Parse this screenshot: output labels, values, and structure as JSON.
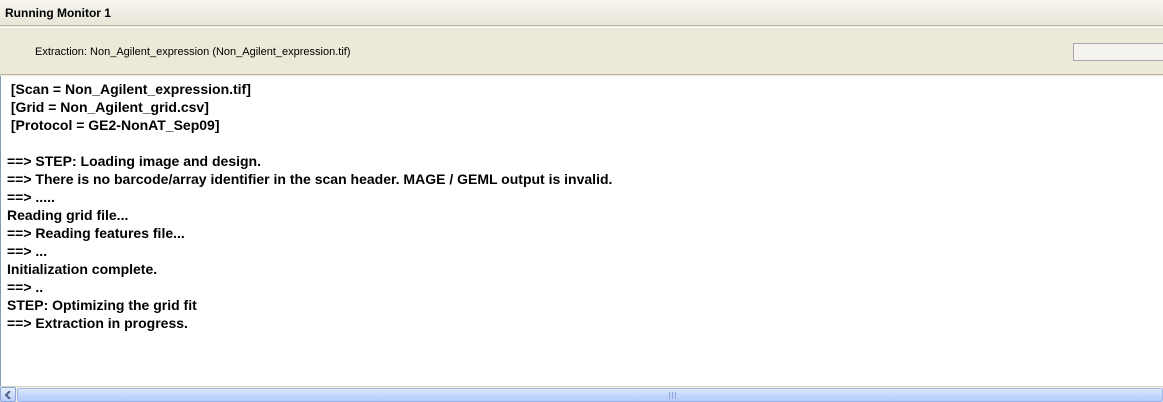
{
  "window": {
    "title": "Running Monitor 1"
  },
  "status": {
    "text": "Extraction: Non_Agilent_expression (Non_Agilent_expression.tif)",
    "progress_fraction": 0
  },
  "log": {
    "lines": [
      " [Scan = Non_Agilent_expression.tif]",
      " [Grid = Non_Agilent_grid.csv]",
      " [Protocol = GE2-NonAT_Sep09]",
      "",
      "==> STEP: Loading image and design.",
      "==> There is no barcode/array identifier in the scan header. MAGE / GEML output is invalid.",
      "==> .....",
      "Reading grid file...",
      "==> Reading features file...",
      "==> ...",
      "Initialization complete.",
      "==> ..",
      "STEP: Optimizing the grid fit",
      "==> Extraction in progress."
    ]
  },
  "scrollbar": {
    "left_icon": "chevron-left-icon",
    "grip_icon": "grip-icon"
  }
}
